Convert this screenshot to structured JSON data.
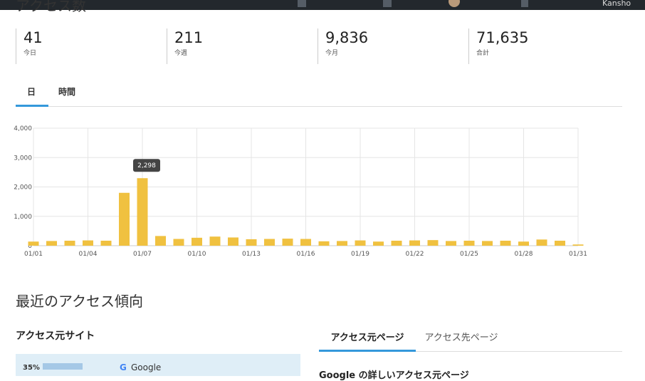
{
  "header": {
    "clipped_title": "アクセス数",
    "username": "Kansho"
  },
  "stats": [
    {
      "value": "41",
      "label": "今日"
    },
    {
      "value": "211",
      "label": "今週"
    },
    {
      "value": "9,836",
      "label": "今月"
    },
    {
      "value": "71,635",
      "label": "合計"
    }
  ],
  "period_tabs": [
    {
      "label": "日",
      "active": true
    },
    {
      "label": "時間",
      "active": false
    }
  ],
  "tooltip": "2,298",
  "colors": {
    "bar": "#f0c140",
    "accent": "#3498db",
    "topbar": "#23282d"
  },
  "chart_data": {
    "type": "bar",
    "categories": [
      "01/01",
      "01/02",
      "01/03",
      "01/04",
      "01/05",
      "01/06",
      "01/07",
      "01/08",
      "01/09",
      "01/10",
      "01/11",
      "01/12",
      "01/13",
      "01/14",
      "01/15",
      "01/16",
      "01/17",
      "01/18",
      "01/19",
      "01/20",
      "01/21",
      "01/22",
      "01/23",
      "01/24",
      "01/25",
      "01/26",
      "01/27",
      "01/28",
      "01/29",
      "01/30",
      "01/31"
    ],
    "tick_labels": [
      "01/01",
      "01/04",
      "01/07",
      "01/10",
      "01/13",
      "01/16",
      "01/19",
      "01/22",
      "01/25",
      "01/28",
      "01/31"
    ],
    "values": [
      140,
      160,
      170,
      180,
      170,
      1800,
      2298,
      330,
      230,
      270,
      310,
      280,
      220,
      230,
      240,
      230,
      150,
      160,
      180,
      140,
      170,
      180,
      190,
      160,
      170,
      160,
      170,
      140,
      210,
      170,
      41
    ],
    "ylim": [
      0,
      4000
    ],
    "yticks": [
      "4,000",
      "3,000",
      "2,000",
      "1,000",
      "0"
    ],
    "grid": true
  },
  "trend": {
    "title": "最近のアクセス傾向",
    "referrers_title": "アクセス元サイト",
    "referrers": [
      {
        "percent": "35%",
        "share": 0.35,
        "name": "Google",
        "icon": "G"
      }
    ],
    "page_tabs": [
      {
        "label": "アクセス元ページ",
        "active": true
      },
      {
        "label": "アクセス先ページ",
        "active": false
      }
    ],
    "detail_heading": "Google の詳しいアクセス元ページ"
  }
}
